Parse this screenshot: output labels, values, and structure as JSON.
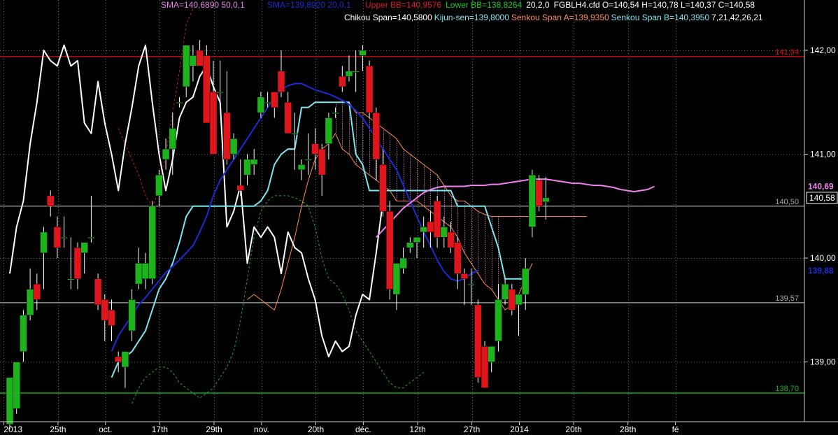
{
  "header": {
    "sma1": "SMA=140,6890  50,0,1",
    "sma2": "SMA=139,8920  20,0,1",
    "upper_bb": "Upper BB=140,9576",
    "lower_bb": "Lower BB=138,8264",
    "bb_params": "20,2,0",
    "ohlc": "FGBLH4.cfd O=140,54 H=140,78 L=140,37 C=140,58",
    "chikou": "Chikou Span=140,5800",
    "kijun": "Kijun-sen=139,8000",
    "senkou_a": "Senkou Span A=139,9350",
    "senkou_b": "Senkou Span B=140,3950",
    "ichimoku_params": "7,21,42,26,21"
  },
  "colors": {
    "background": "#000000",
    "up_candle": "#1db31d",
    "down_candle": "#e0161d",
    "sma50": "#ee82ee",
    "sma20": "#1a2bd6",
    "chikou": "#ffffff",
    "kijun": "#7fe7f0",
    "senkou_a": "#ff8c5a",
    "senkou_b": "#ff8c5a",
    "bb": "#cc2200",
    "bb_lower": "#22aa22",
    "cloud": "#d070b0",
    "h_red": "#dd1111",
    "h_grey": "#aaaaaa",
    "h_green": "#11bb11"
  },
  "chart_data": {
    "type": "candlestick",
    "title": "FGBLH4.cfd",
    "ylim": [
      138.4,
      142.5
    ],
    "y_ticks": [
      "142,00",
      "141,00",
      "140,00",
      "139,00"
    ],
    "y_tick_values": [
      142.0,
      141.0,
      140.0,
      139.0
    ],
    "x_ticks": [
      "2013",
      "25th",
      "oct.",
      "17th",
      "29th",
      "nov.",
      "20th",
      "déc.",
      "12th",
      "27th",
      "2014",
      "20th",
      "28th",
      "fé"
    ],
    "x_tick_slots": [
      0,
      8,
      15,
      23,
      31,
      38,
      46,
      53,
      61,
      69,
      76,
      84,
      92,
      99
    ],
    "horizontal_levels": [
      {
        "label": "141,94",
        "value": 141.94,
        "color": "h_red"
      },
      {
        "label": "140,50",
        "value": 140.5,
        "color": "h_grey"
      },
      {
        "label": "139,57",
        "value": 139.57,
        "color": "h_grey"
      },
      {
        "label": "138,70",
        "value": 138.7,
        "color": "h_green"
      }
    ],
    "price_tags": [
      {
        "label": "140,69",
        "value": 140.69,
        "color": "sma50"
      },
      {
        "label": "140,58",
        "value": 140.58,
        "color": "last"
      },
      {
        "label": "139,88",
        "value": 139.88,
        "color": "sma20"
      }
    ],
    "candles": [
      [
        138.4,
        138.85,
        138.35,
        138.85
      ],
      [
        138.55,
        139.0,
        138.5,
        139.0
      ],
      [
        139.1,
        139.5,
        139.0,
        139.45
      ],
      [
        139.45,
        139.9,
        139.4,
        139.7
      ],
      [
        139.75,
        139.85,
        139.5,
        139.6
      ],
      [
        140.05,
        140.3,
        139.7,
        140.25
      ],
      [
        140.6,
        140.65,
        140.4,
        140.5
      ],
      [
        140.3,
        140.4,
        140.0,
        140.1
      ],
      [
        140.2,
        140.4,
        140.1,
        140.2
      ],
      [
        139.8,
        140.2,
        139.7,
        139.8
      ],
      [
        140.1,
        140.15,
        139.7,
        139.8
      ],
      [
        140.05,
        140.15,
        139.85,
        140.15
      ],
      [
        140.2,
        140.6,
        140.15,
        140.2
      ],
      [
        139.8,
        139.85,
        139.5,
        139.55
      ],
      [
        139.6,
        139.65,
        139.2,
        139.4
      ],
      [
        139.5,
        139.6,
        139.2,
        139.35
      ],
      [
        139.05,
        139.1,
        138.9,
        139.0
      ],
      [
        138.95,
        139.1,
        138.75,
        139.1
      ],
      [
        139.3,
        139.7,
        139.2,
        139.6
      ],
      [
        139.75,
        140.1,
        139.7,
        139.95
      ],
      [
        139.8,
        140.05,
        139.7,
        139.95
      ],
      [
        139.8,
        140.55,
        139.75,
        140.5
      ],
      [
        140.6,
        140.85,
        140.5,
        140.8
      ],
      [
        140.95,
        141.15,
        140.85,
        141.05
      ],
      [
        141.05,
        141.4,
        140.8,
        141.25
      ],
      [
        141.5,
        141.55,
        141.45,
        141.5
      ],
      [
        141.65,
        142.0,
        141.55,
        142.05
      ],
      [
        141.85,
        142.05,
        141.7,
        141.95
      ],
      [
        142.0,
        142.1,
        141.9,
        141.85
      ],
      [
        141.95,
        142.05,
        141.3,
        141.3
      ],
      [
        141.6,
        141.9,
        141.0,
        141.0
      ],
      [
        141.6,
        141.9,
        141.5,
        141.6
      ],
      [
        141.4,
        141.8,
        140.9,
        140.95
      ],
      [
        141.0,
        141.2,
        140.95,
        141.15
      ],
      [
        140.7,
        140.95,
        140.6,
        140.65
      ],
      [
        140.8,
        141.0,
        140.7,
        140.95
      ],
      [
        140.9,
        141.05,
        140.8,
        140.95
      ],
      [
        141.4,
        141.6,
        141.35,
        141.55
      ],
      [
        141.5,
        141.6,
        141.45,
        141.5
      ],
      [
        141.6,
        141.6,
        141.35,
        141.45
      ],
      [
        141.8,
        142.0,
        141.55,
        141.6
      ],
      [
        141.5,
        141.6,
        141.2,
        141.2
      ],
      [
        141.2,
        141.4,
        140.85,
        141.2
      ],
      [
        140.85,
        140.95,
        140.75,
        140.9
      ],
      [
        140.95,
        141.2,
        140.8,
        140.95
      ],
      [
        141.1,
        141.25,
        140.85,
        141.0
      ],
      [
        141.05,
        141.1,
        140.6,
        140.8
      ],
      [
        141.1,
        141.4,
        140.95,
        141.35
      ],
      [
        141.4,
        141.45,
        141.35,
        141.4
      ],
      [
        141.75,
        141.85,
        141.6,
        141.65
      ],
      [
        141.75,
        141.95,
        141.7,
        141.8
      ],
      [
        141.8,
        142.0,
        141.6,
        141.8
      ],
      [
        141.95,
        142.05,
        141.8,
        142.0
      ],
      [
        141.85,
        141.9,
        141.35,
        141.4
      ],
      [
        141.4,
        141.45,
        140.75,
        140.95
      ],
      [
        140.9,
        141.05,
        140.4,
        140.45
      ],
      [
        140.45,
        140.55,
        139.6,
        139.7
      ],
      [
        139.65,
        139.8,
        139.5,
        139.95
      ],
      [
        139.9,
        140.1,
        139.85,
        140.0
      ],
      [
        140.1,
        140.2,
        140.05,
        140.15
      ],
      [
        140.15,
        140.2,
        140.0,
        140.2
      ],
      [
        140.25,
        140.4,
        140.1,
        140.3
      ],
      [
        140.35,
        140.45,
        140.1,
        140.25
      ],
      [
        140.55,
        140.6,
        140.1,
        140.2
      ],
      [
        140.2,
        140.4,
        140.1,
        140.3
      ],
      [
        140.25,
        140.35,
        140.05,
        140.1
      ],
      [
        140.15,
        140.2,
        139.7,
        139.85
      ],
      [
        139.85,
        139.9,
        139.55,
        139.8
      ],
      [
        139.75,
        139.9,
        139.55,
        139.75
      ],
      [
        139.55,
        139.6,
        138.8,
        138.85
      ],
      [
        139.15,
        139.2,
        138.75,
        138.75
      ],
      [
        139.0,
        139.15,
        138.9,
        139.15
      ],
      [
        139.2,
        139.75,
        139.1,
        139.6
      ],
      [
        139.6,
        139.8,
        139.55,
        139.75
      ],
      [
        139.7,
        139.75,
        139.45,
        139.5
      ],
      [
        139.55,
        139.65,
        139.25,
        139.65
      ],
      [
        139.65,
        140.0,
        139.5,
        139.9
      ],
      [
        140.3,
        140.85,
        140.2,
        140.8
      ],
      [
        140.75,
        140.8,
        140.45,
        140.5
      ],
      [
        140.54,
        140.78,
        140.37,
        140.58
      ]
    ],
    "series": [
      {
        "name": "SMA 50",
        "color_key": "sma50",
        "start": 54,
        "values": [
          140.2,
          140.27,
          140.34,
          140.41,
          140.48,
          140.53,
          140.58,
          140.63,
          140.66,
          140.68,
          140.69,
          140.69,
          140.69,
          140.69,
          140.7,
          140.7,
          140.7,
          140.71,
          140.71,
          140.72,
          140.73,
          140.74,
          140.75,
          140.76,
          140.76,
          140.76,
          140.75,
          140.74,
          140.73,
          140.72,
          140.72,
          140.71,
          140.7,
          140.7,
          140.69,
          140.68,
          140.66,
          140.65,
          140.64,
          140.65,
          140.66,
          140.69
        ]
      },
      {
        "name": "SMA 20",
        "color_key": "sma20",
        "start": 15,
        "values": [
          139.1,
          139.25,
          139.35,
          139.45,
          139.55,
          139.62,
          139.7,
          139.78,
          139.86,
          139.92,
          139.98,
          140.05,
          140.12,
          140.25,
          140.4,
          140.6,
          140.75,
          140.85,
          140.95,
          141.05,
          141.15,
          141.25,
          141.35,
          141.45,
          141.55,
          141.62,
          141.66,
          141.68,
          141.68,
          141.65,
          141.62,
          141.6,
          141.58,
          141.55,
          141.52,
          141.48,
          141.42,
          141.35,
          141.25,
          141.15,
          141.05,
          140.95,
          140.85,
          140.7,
          140.55,
          140.4,
          140.25,
          140.12,
          139.98,
          139.87,
          139.8,
          139.78,
          139.8,
          139.85,
          139.88
        ]
      },
      {
        "name": "Kijun-sen",
        "color_key": "kijun",
        "start": 15,
        "values": [
          138.85,
          139.0,
          139.05,
          139.1,
          139.2,
          139.3,
          139.5,
          139.7,
          139.8,
          139.95,
          140.15,
          140.4,
          140.5,
          140.5,
          140.5,
          140.5,
          140.5,
          140.5,
          140.5,
          140.5,
          140.5,
          140.5,
          140.55,
          140.65,
          140.9,
          141.0,
          141.05,
          141.05,
          141.45,
          141.45,
          141.5,
          141.5,
          141.5,
          141.5,
          141.5,
          141.5,
          141.0,
          140.9,
          140.65,
          140.65,
          140.65,
          140.65,
          140.65,
          140.65,
          140.65,
          140.65,
          140.65,
          140.65,
          140.65,
          140.65,
          140.65,
          140.5,
          140.5,
          140.5,
          140.5,
          140.5,
          140.3,
          140.1,
          139.8,
          139.8,
          139.8,
          139.8
        ]
      },
      {
        "name": "Senkou Span A",
        "color_key": "senkou_a",
        "start": 35,
        "values": [
          139.6,
          139.65,
          139.6,
          139.55,
          139.5,
          139.7,
          139.95,
          140.2,
          140.5,
          140.75,
          140.95,
          141.05,
          141.1,
          141.2,
          141.05,
          141.0,
          140.9,
          140.85,
          140.8,
          140.75,
          140.7,
          140.65,
          140.55,
          140.55,
          140.55,
          140.55,
          140.5,
          140.45,
          140.4,
          140.35,
          140.3,
          140.2,
          140.05,
          139.95,
          139.85,
          139.75,
          139.7,
          139.6,
          139.5,
          139.55,
          139.65,
          139.8,
          139.95
        ]
      },
      {
        "name": "Senkou Span B",
        "color_key": "senkou_b",
        "start": 48,
        "values": [
          141.5,
          141.5,
          141.5,
          141.4,
          141.4,
          141.35,
          141.3,
          141.25,
          141.2,
          141.15,
          141.05,
          141.0,
          140.95,
          140.9,
          140.85,
          140.8,
          140.7,
          140.6,
          140.55,
          140.55,
          140.5,
          140.45,
          140.42,
          140.4,
          140.4,
          140.4,
          140.4,
          140.4,
          140.4,
          140.4,
          140.4,
          140.4,
          140.4,
          140.4,
          140.4,
          140.4,
          140.4,
          140.4
        ]
      },
      {
        "name": "Chikou Span",
        "color_key": "chikou",
        "start": 0,
        "values": [
          139.85,
          140.3,
          140.55,
          141.1,
          141.5,
          142.0,
          141.9,
          141.85,
          142.05,
          141.85,
          141.9,
          141.3,
          141.2,
          141.7,
          141.3,
          141.0,
          140.65,
          141.1,
          141.45,
          141.85,
          142.05,
          141.5,
          141.0,
          140.65,
          140.95,
          141.35,
          141.5,
          141.55,
          141.75,
          141.85,
          141.65,
          141.5,
          140.3,
          140.45,
          140.7,
          139.95,
          140.3,
          140.2,
          140.3,
          140.2,
          139.85,
          140.25,
          140.1,
          140.05,
          139.8,
          139.6,
          139.25,
          139.05,
          139.2,
          139.1,
          139.15,
          139.45,
          139.65,
          139.6,
          140.05,
          140.55
        ]
      }
    ],
    "cloud_range": [
      48,
      72
    ],
    "bb_upper": {
      "start": 16,
      "values": [
        141.25,
        141.1,
        140.95,
        140.8,
        140.6,
        140.5,
        140.65,
        141.0,
        141.4,
        141.8,
        142.25,
        142.4
      ]
    },
    "bb_lower": {
      "start": 18,
      "values": [
        138.6,
        138.75,
        138.85,
        138.9,
        138.95,
        138.95,
        138.9,
        138.8,
        138.75,
        138.7,
        138.65,
        138.7,
        138.75,
        138.85,
        138.95,
        139.1,
        139.4,
        139.8,
        140.2,
        140.45,
        140.55,
        140.6,
        140.6,
        140.6,
        140.58,
        140.55,
        140.5,
        140.3,
        140.0,
        139.8,
        139.75,
        139.65,
        139.5,
        139.3,
        139.2,
        139.1,
        139.0,
        138.9,
        138.8,
        138.75,
        138.75,
        138.8,
        138.85,
        138.9
      ]
    }
  }
}
